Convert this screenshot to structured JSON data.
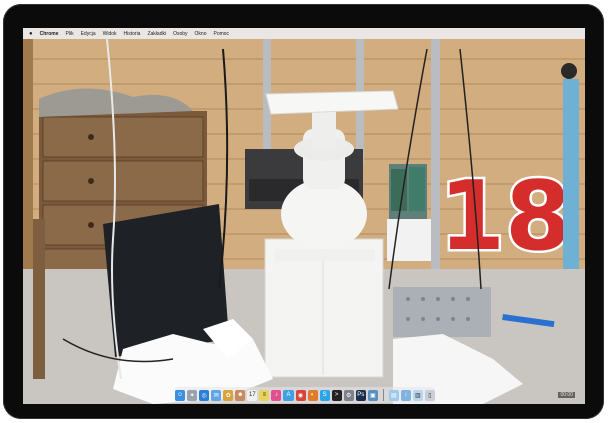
{
  "menubar": {
    "apple": "",
    "app_name": "Chrome",
    "items": [
      "Plik",
      "Edycja",
      "Widok",
      "Historia",
      "Zakładki",
      "Osoby",
      "Okno",
      "Pomoc"
    ]
  },
  "dock": {
    "apps": [
      {
        "name": "finder",
        "color": "#3a8fe0",
        "glyph": "☺"
      },
      {
        "name": "launchpad",
        "color": "#9aa3ad",
        "glyph": "✦"
      },
      {
        "name": "safari",
        "color": "#2c7fd6",
        "glyph": "◎"
      },
      {
        "name": "mail",
        "color": "#5fa5e8",
        "glyph": "✉"
      },
      {
        "name": "photos",
        "color": "#d9a23b",
        "glyph": "✿"
      },
      {
        "name": "contacts",
        "color": "#c98b5d",
        "glyph": "☻"
      },
      {
        "name": "calendar",
        "color": "#f0f0f0",
        "glyph": "17"
      },
      {
        "name": "notes",
        "color": "#e9d35a",
        "glyph": "≡"
      },
      {
        "name": "itunes",
        "color": "#e24f8e",
        "glyph": "♪"
      },
      {
        "name": "app-store",
        "color": "#3ea1e6",
        "glyph": "A"
      },
      {
        "name": "chrome",
        "color": "#d8443a",
        "glyph": "◉"
      },
      {
        "name": "firefox",
        "color": "#e07b2a",
        "glyph": "◐"
      },
      {
        "name": "skype",
        "color": "#2aa6e8",
        "glyph": "S"
      },
      {
        "name": "terminal",
        "color": "#222222",
        "glyph": ">"
      },
      {
        "name": "system-preferences",
        "color": "#7d8188",
        "glyph": "⚙"
      },
      {
        "name": "photoshop",
        "color": "#18304d",
        "glyph": "Ps"
      },
      {
        "name": "preview",
        "color": "#5b8fbd",
        "glyph": "▣"
      }
    ],
    "trailing": [
      {
        "name": "folder",
        "color": "#9fc9ec",
        "glyph": "▤"
      },
      {
        "name": "downloads",
        "color": "#7fb3e0",
        "glyph": "↓"
      },
      {
        "name": "documents",
        "color": "#b8d6f0",
        "glyph": "▥"
      },
      {
        "name": "trash",
        "color": "#c9cfd6",
        "glyph": "▯"
      }
    ]
  },
  "counter": "18",
  "corner_badge": "00:00"
}
